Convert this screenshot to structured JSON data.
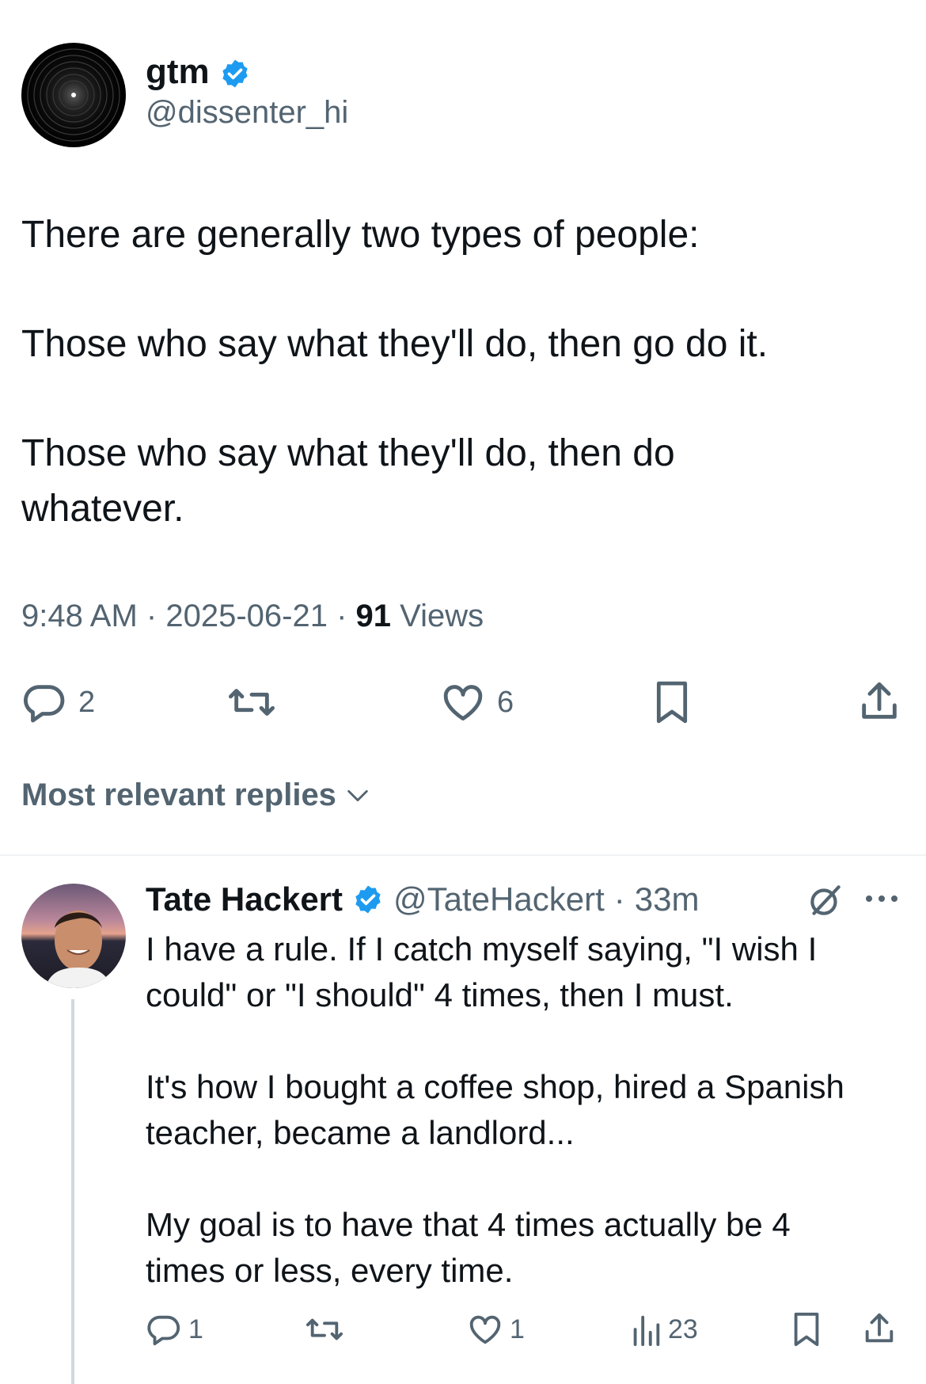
{
  "tweet": {
    "display_name": "gtm",
    "handle": "@dissenter_hi",
    "lines": [
      "There are generally two types of people:",
      "Those who say what they'll do, then go do it.",
      "Those who say what they'll do, then do",
      "whatever."
    ],
    "time": "9:48 AM",
    "date": "2025-06-21",
    "views_count": "91",
    "views_label": "Views",
    "separator": "·",
    "reply_count": "2",
    "like_count": "6"
  },
  "replies_sort": {
    "label": "Most relevant replies"
  },
  "reply": {
    "display_name": "Tate Hackert",
    "handle": "@TateHackert",
    "separator": "·",
    "age": "33m",
    "lines": [
      "I have a rule. If I catch myself saying, \"I wish I",
      "could\" or \"I should\" 4 times, then I must.",
      "It's how I bought a coffee shop, hired a Spanish",
      "teacher, became a landlord...",
      "My goal is to have that 4 times actually be 4",
      "times or less, every time."
    ],
    "reply_count": "1",
    "like_count": "1",
    "view_count": "23"
  },
  "colors": {
    "accent": "#1d9bf0",
    "text": "#0f1419",
    "secondary": "#536471",
    "divider": "#eff3f4"
  },
  "icons": [
    "verified-icon",
    "reply-icon",
    "retweet-icon",
    "like-icon",
    "bookmark-icon",
    "share-icon",
    "chevron-down-icon",
    "grok-icon",
    "more-icon",
    "views-icon"
  ]
}
